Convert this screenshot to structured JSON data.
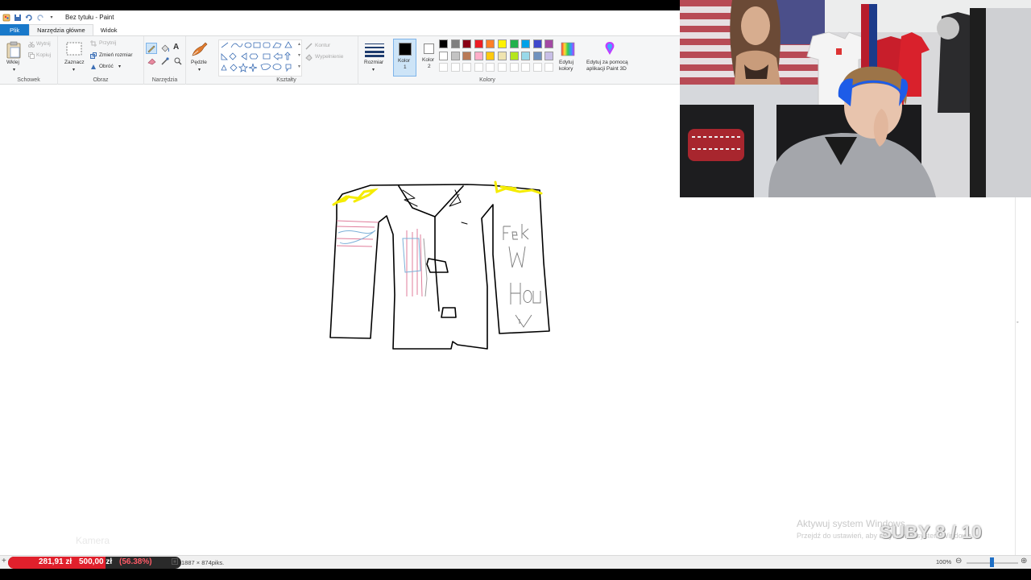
{
  "window": {
    "title": "Bez tytułu - Paint"
  },
  "tabs": [
    {
      "label": "Plik"
    },
    {
      "label": "Narzędzia główne"
    },
    {
      "label": "Widok"
    }
  ],
  "ribbon": {
    "clipboard": {
      "paste": "Wklej",
      "cut": "Wytnij",
      "copy": "Kopiuj",
      "group": "Schowek"
    },
    "image": {
      "select": "Zaznacz",
      "crop": "Przytnij",
      "resize": "Zmień rozmiar",
      "rotate": "Obróć",
      "group": "Obraz"
    },
    "tools": {
      "group": "Narzędzia"
    },
    "brushes": {
      "label": "Pędzle"
    },
    "shapes": {
      "outline": "Kontur",
      "fill": "Wypełnienie",
      "group": "Kształty"
    },
    "size": {
      "label": "Rozmiar"
    },
    "colors": {
      "color1": "Kolor",
      "color1_num": "1",
      "color2": "Kolor",
      "color2_num": "2",
      "edit": "Edytuj",
      "edit2": "kolory",
      "paint3d": "Edytuj za pomocą",
      "paint3d2": "aplikacji Paint 3D",
      "group": "Kolory",
      "color1_value": "#000000",
      "color2_value": "#ffffff",
      "palette_row1": [
        "#000000",
        "#7f7f7f",
        "#880015",
        "#ed1c24",
        "#ff7f27",
        "#fff200",
        "#22b14c",
        "#00a2e8",
        "#3f48cc",
        "#a349a4"
      ],
      "palette_row2": [
        "#ffffff",
        "#c3c3c3",
        "#b97a57",
        "#ffaec9",
        "#ffc90e",
        "#efe4b0",
        "#b5e61d",
        "#99d9ea",
        "#7092be",
        "#c8bfe7"
      ]
    }
  },
  "status": {
    "dimensions": "1887 × 874piks.",
    "zoom": "100%"
  },
  "donation": {
    "current": "281,91 zł",
    "goal": "500,00 zł",
    "percent": "(56.38%)",
    "progress_fraction": 0.5638
  },
  "overlays": {
    "kamera": "Kamera",
    "activate_title": "Aktywuj system Windows",
    "activate_sub": "Przejdź do ustawień, aby aktywować system Windows.",
    "suby": "SUBY 8 / 10"
  }
}
